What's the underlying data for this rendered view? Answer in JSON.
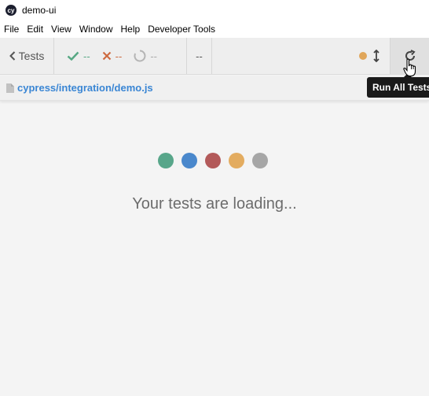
{
  "window": {
    "title": "demo-ui",
    "logo_text": "cy"
  },
  "menu": [
    "File",
    "Edit",
    "View",
    "Window",
    "Help",
    "Developer Tools"
  ],
  "toolbar": {
    "back_label": "Tests",
    "passed": "--",
    "failed": "--",
    "pending": "--",
    "duration": "--",
    "status_color": "#e0a65a"
  },
  "spec": {
    "path": "cypress/integration/demo.js"
  },
  "tooltip": {
    "text": "Run All Tests"
  },
  "loader": {
    "dots": [
      "#58a68a",
      "#4a88cc",
      "#b35a5a",
      "#e3ac60",
      "#a6a6a6"
    ],
    "text": "Your tests are loading..."
  }
}
